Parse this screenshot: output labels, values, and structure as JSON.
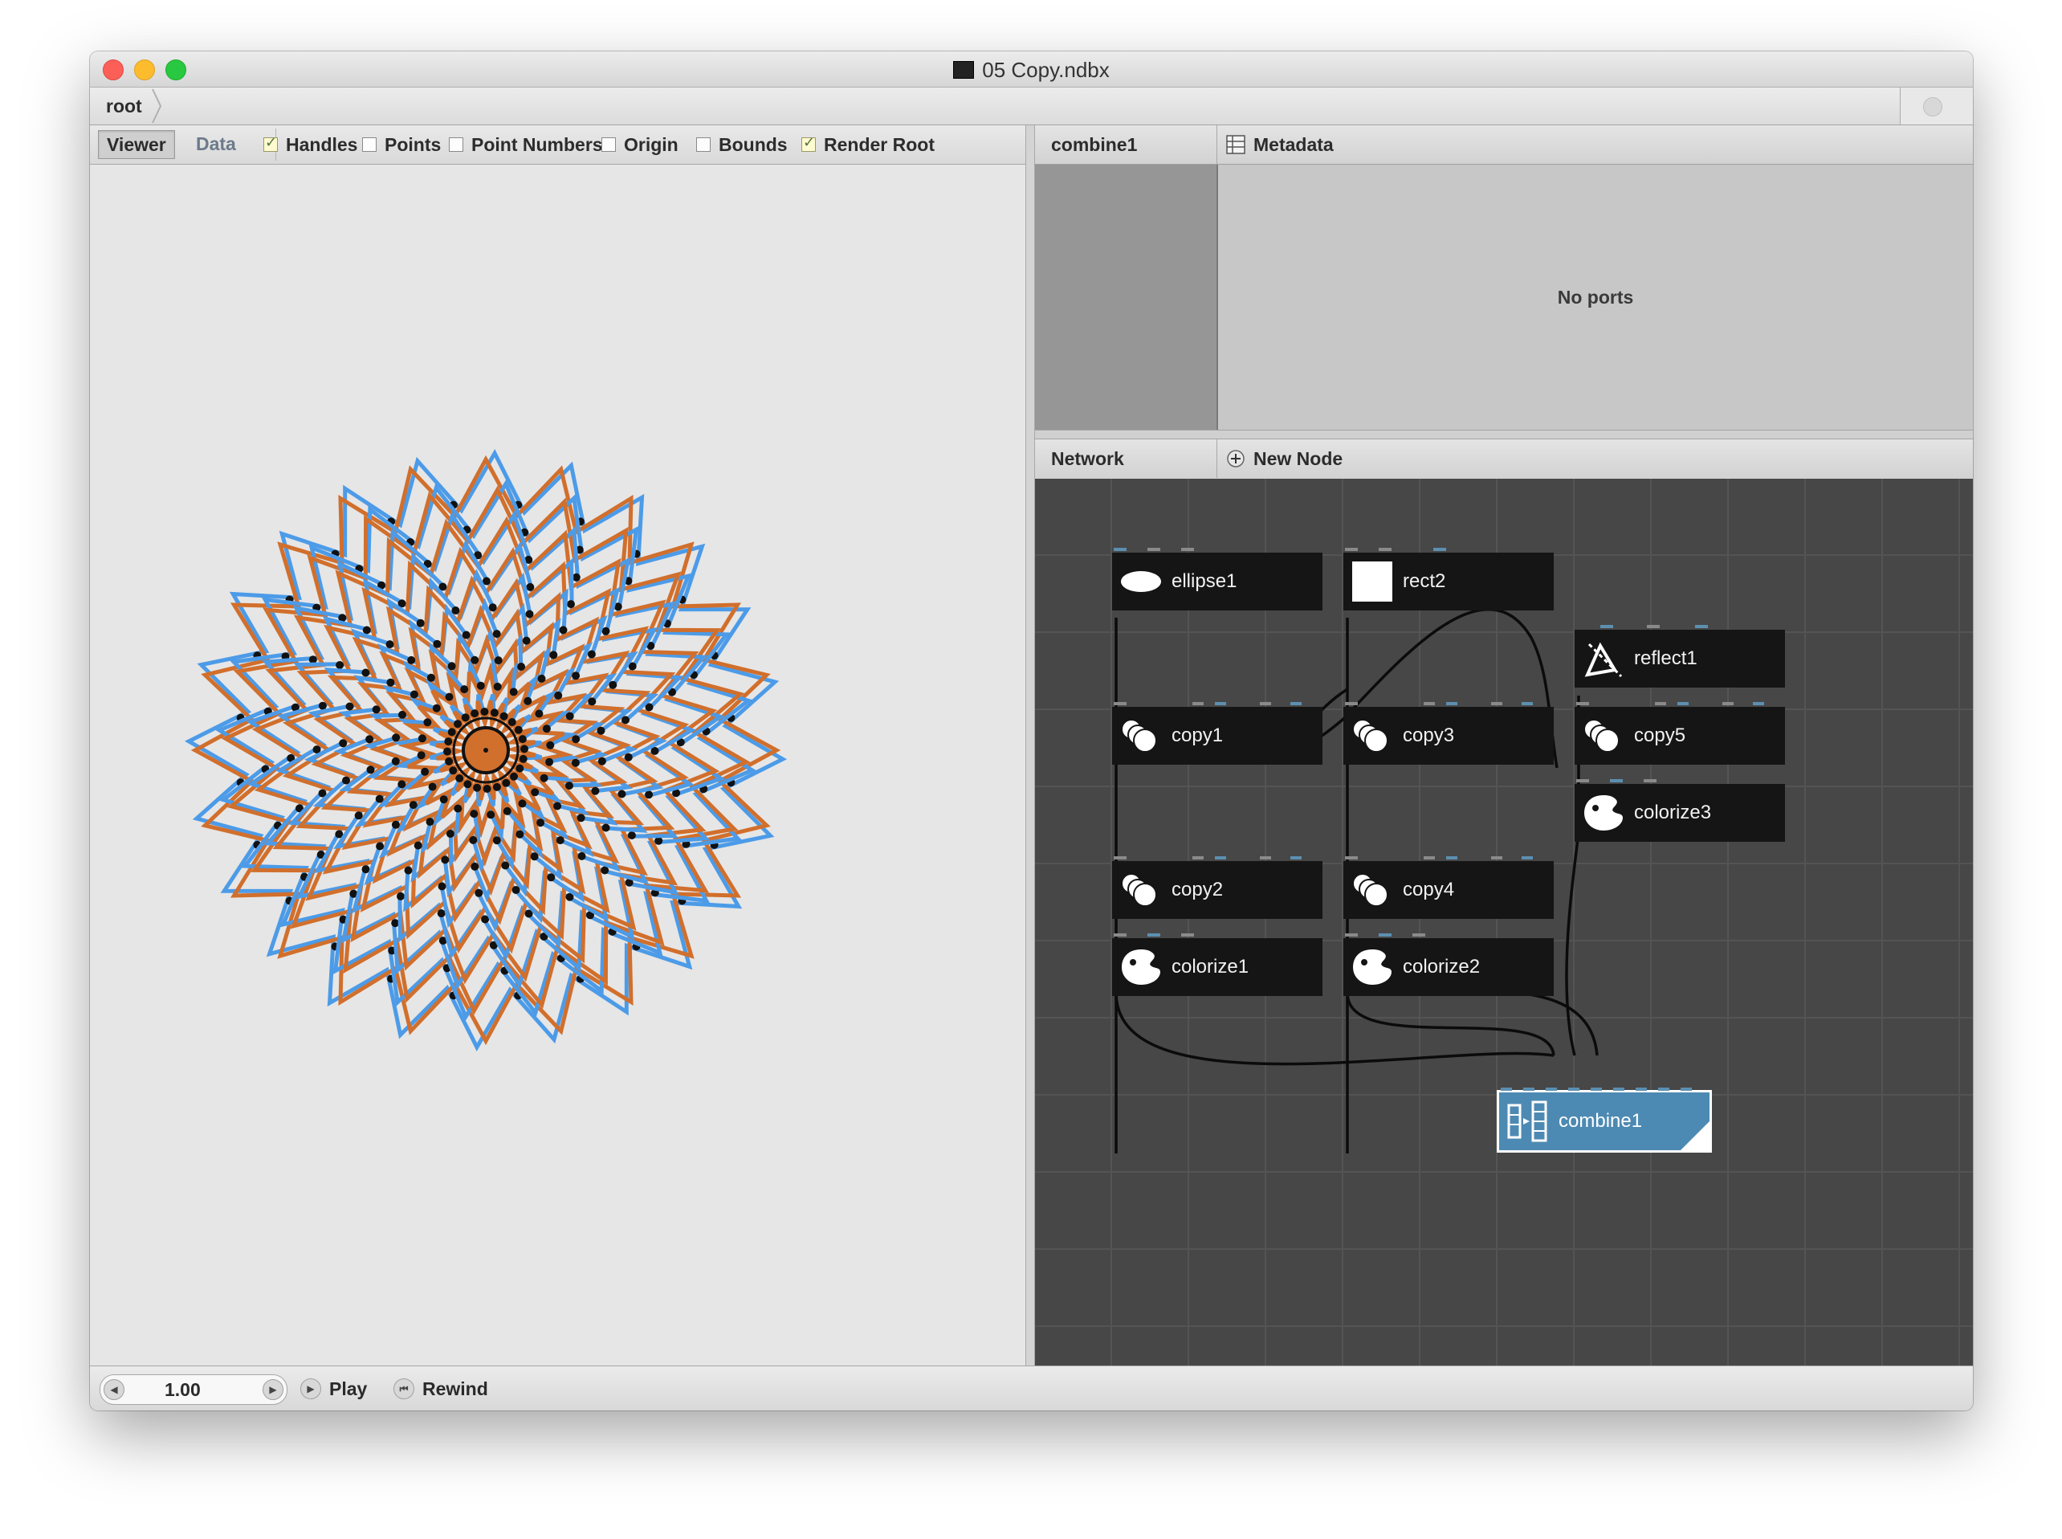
{
  "window": {
    "title": "05 Copy.ndbx"
  },
  "address": {
    "crumbs": [
      "root"
    ]
  },
  "viewer": {
    "tabs": {
      "viewer": "Viewer",
      "data": "Data"
    },
    "options": [
      {
        "label": "Handles",
        "checked": true
      },
      {
        "label": "Points",
        "checked": false
      },
      {
        "label": "Point Numbers",
        "checked": false
      },
      {
        "label": "Origin",
        "checked": false
      },
      {
        "label": "Bounds",
        "checked": false
      },
      {
        "label": "Render Root",
        "checked": true
      }
    ],
    "colors": {
      "stroke_a": "#d16f2c",
      "stroke_b": "#4c9be8",
      "center": "#d16f2c",
      "point": "#111111",
      "background": "#e6e6e6"
    }
  },
  "ports_panel": {
    "node_name": "combine1",
    "metadata_label": "Metadata",
    "empty_text": "No ports"
  },
  "network": {
    "title": "Network",
    "new_node_label": "New Node",
    "nodes": [
      {
        "id": "ellipse1",
        "label": "ellipse1",
        "icon": "ellipse-icon"
      },
      {
        "id": "rect2",
        "label": "rect2",
        "icon": "rect-icon"
      },
      {
        "id": "reflect1",
        "label": "reflect1",
        "icon": "reflect-icon"
      },
      {
        "id": "copy1",
        "label": "copy1",
        "icon": "copy-icon"
      },
      {
        "id": "copy3",
        "label": "copy3",
        "icon": "copy-icon"
      },
      {
        "id": "copy5",
        "label": "copy5",
        "icon": "copy-icon"
      },
      {
        "id": "colorize3",
        "label": "colorize3",
        "icon": "colorize-icon"
      },
      {
        "id": "copy2",
        "label": "copy2",
        "icon": "copy-icon"
      },
      {
        "id": "copy4",
        "label": "copy4",
        "icon": "copy-icon"
      },
      {
        "id": "colorize1",
        "label": "colorize1",
        "icon": "colorize-icon"
      },
      {
        "id": "colorize2",
        "label": "colorize2",
        "icon": "colorize-icon"
      },
      {
        "id": "combine1",
        "label": "combine1",
        "icon": "combine-icon",
        "selected": true
      }
    ],
    "colors": {
      "node": "#151515",
      "selected": "#4d8ab3",
      "port": "#5c8fb0",
      "grid": "#545454",
      "background": "#474747"
    }
  },
  "bottom": {
    "frame": "1.00",
    "play_label": "Play",
    "rewind_label": "Rewind"
  }
}
